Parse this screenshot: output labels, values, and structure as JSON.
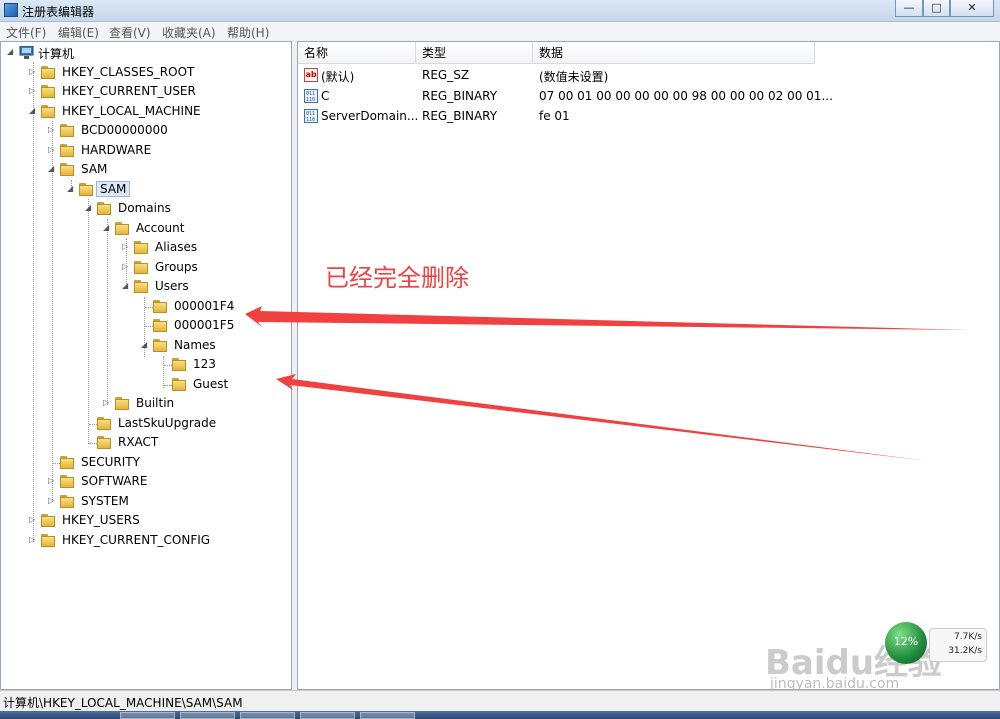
{
  "window": {
    "title": "注册表编辑器",
    "minimize": "—",
    "maximize": "□",
    "close": "✕"
  },
  "menu": [
    "文件(F)",
    "编辑(E)",
    "查看(V)",
    "收藏夹(A)",
    "帮助(H)"
  ],
  "tree": {
    "root": "计算机",
    "nodes": [
      {
        "label": "HKEY_CLASSES_ROOT",
        "expander": "▷"
      },
      {
        "label": "HKEY_CURRENT_USER",
        "expander": "▷"
      },
      {
        "label": "HKEY_LOCAL_MACHINE",
        "expander": "◢"
      },
      {
        "label": "BCD00000000",
        "expander": "▷"
      },
      {
        "label": "HARDWARE",
        "expander": "▷"
      },
      {
        "label": "SAM",
        "expander": "◢"
      },
      {
        "label": "SAM",
        "expander": "◢",
        "selected": true
      },
      {
        "label": "Domains",
        "expander": "◢"
      },
      {
        "label": "Account",
        "expander": "◢"
      },
      {
        "label": "Aliases",
        "expander": "▷"
      },
      {
        "label": "Groups",
        "expander": "▷"
      },
      {
        "label": "Users",
        "expander": "◢"
      },
      {
        "label": "000001F4",
        "expander": ""
      },
      {
        "label": "000001F5",
        "expander": ""
      },
      {
        "label": "Names",
        "expander": "◢"
      },
      {
        "label": "123",
        "expander": ""
      },
      {
        "label": "Guest",
        "expander": ""
      },
      {
        "label": "Builtin",
        "expander": "▷"
      },
      {
        "label": "LastSkuUpgrade",
        "expander": ""
      },
      {
        "label": "RXACT",
        "expander": ""
      },
      {
        "label": "SECURITY",
        "expander": ""
      },
      {
        "label": "SOFTWARE",
        "expander": "▷"
      },
      {
        "label": "SYSTEM",
        "expander": "▷"
      },
      {
        "label": "HKEY_USERS",
        "expander": "▷"
      },
      {
        "label": "HKEY_CURRENT_CONFIG",
        "expander": "▷"
      }
    ]
  },
  "list": {
    "columns": [
      "名称",
      "类型",
      "数据"
    ],
    "rows": [
      {
        "icon": "ab",
        "name": "(默认)",
        "type": "REG_SZ",
        "data": "(数值未设置)"
      },
      {
        "icon": "011 110",
        "name": "C",
        "type": "REG_BINARY",
        "data": "07 00 01 00 00 00 00 00 98 00 00 00 02 00 01..."
      },
      {
        "icon": "011 110",
        "name": "ServerDomain...",
        "type": "REG_BINARY",
        "data": "fe 01"
      }
    ]
  },
  "annotation": "已经完全删除",
  "status": "计算机\\HKEY_LOCAL_MACHINE\\SAM\\SAM",
  "widget": {
    "percent": "12%",
    "up": "7.7K/s",
    "down": "31.2K/s"
  },
  "watermark": {
    "brand": "Baidu经验",
    "url": "jingyan.baidu.com"
  },
  "colors": {
    "annotation": "#f04040",
    "selection": "#dce8f7"
  }
}
